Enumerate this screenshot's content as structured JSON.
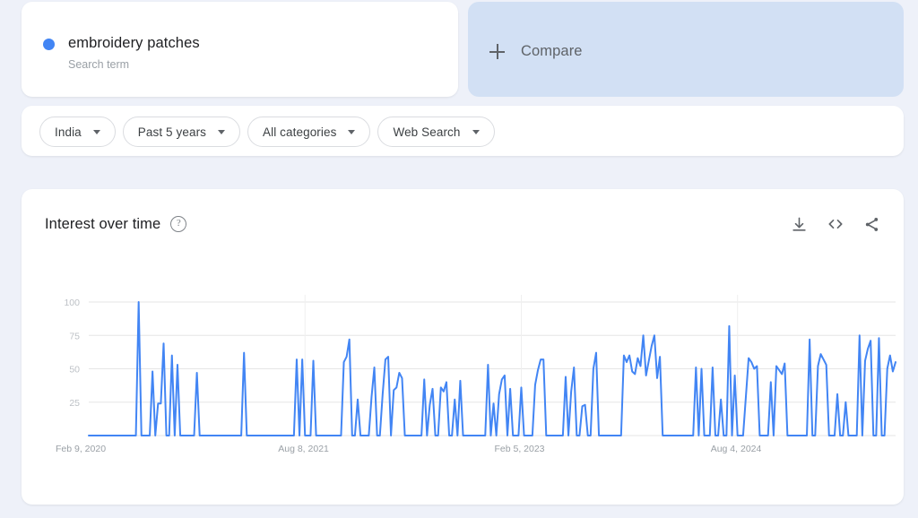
{
  "search_term": {
    "name": "embroidery patches",
    "type_label": "Search term",
    "dot_color": "#4285f4"
  },
  "compare": {
    "label": "Compare",
    "icon": "plus-icon"
  },
  "filters": [
    {
      "label": "India",
      "name": "location-filter"
    },
    {
      "label": "Past 5 years",
      "name": "time-range-filter"
    },
    {
      "label": "All categories",
      "name": "category-filter"
    },
    {
      "label": "Web Search",
      "name": "search-type-filter"
    }
  ],
  "chart_panel": {
    "title": "Interest over time",
    "help_icon": "help-circle-icon",
    "tools": [
      {
        "name": "download-icon",
        "label": "Download"
      },
      {
        "name": "embed-code-icon",
        "label": "Embed"
      },
      {
        "name": "share-icon",
        "label": "Share"
      }
    ]
  },
  "chart_data": {
    "type": "line",
    "title": "Interest over time",
    "xlabel": "",
    "ylabel": "",
    "ylim": [
      0,
      100
    ],
    "yticks": [
      25,
      50,
      75,
      100
    ],
    "grid": true,
    "legend": false,
    "line_color": "#4285f4",
    "x_tick_labels": [
      "Feb 9, 2020",
      "Aug 8, 2021",
      "Feb 5, 2023",
      "Aug 4, 2024"
    ],
    "x_tick_positions": [
      0,
      78,
      156,
      234
    ],
    "series": [
      {
        "name": "embroidery patches",
        "values": [
          0,
          0,
          0,
          0,
          0,
          0,
          0,
          0,
          0,
          0,
          0,
          0,
          0,
          0,
          0,
          0,
          0,
          0,
          100,
          0,
          0,
          0,
          0,
          48,
          0,
          24,
          24,
          69,
          0,
          0,
          60,
          0,
          53,
          0,
          0,
          0,
          0,
          0,
          0,
          47,
          0,
          0,
          0,
          0,
          0,
          0,
          0,
          0,
          0,
          0,
          0,
          0,
          0,
          0,
          0,
          0,
          62,
          0,
          0,
          0,
          0,
          0,
          0,
          0,
          0,
          0,
          0,
          0,
          0,
          0,
          0,
          0,
          0,
          0,
          0,
          57,
          0,
          57,
          0,
          0,
          0,
          56,
          0,
          0,
          0,
          0,
          0,
          0,
          0,
          0,
          0,
          0,
          55,
          59,
          72,
          0,
          0,
          27,
          0,
          0,
          0,
          0,
          29,
          51,
          0,
          0,
          31,
          57,
          59,
          0,
          34,
          36,
          47,
          43,
          0,
          0,
          0,
          0,
          0,
          0,
          0,
          42,
          0,
          23,
          35,
          0,
          0,
          36,
          33,
          40,
          0,
          0,
          27,
          0,
          41,
          0,
          0,
          0,
          0,
          0,
          0,
          0,
          0,
          0,
          53,
          0,
          24,
          0,
          31,
          42,
          45,
          0,
          35,
          0,
          0,
          0,
          36,
          0,
          0,
          0,
          0,
          38,
          49,
          57,
          57,
          0,
          0,
          0,
          0,
          0,
          0,
          0,
          44,
          0,
          33,
          51,
          0,
          0,
          22,
          23,
          0,
          0,
          50,
          62,
          0,
          0,
          0,
          0,
          0,
          0,
          0,
          0,
          0,
          60,
          55,
          60,
          48,
          46,
          58,
          52,
          75,
          45,
          56,
          67,
          75,
          43,
          59,
          0,
          0,
          0,
          0,
          0,
          0,
          0,
          0,
          0,
          0,
          0,
          0,
          51,
          0,
          50,
          0,
          0,
          0,
          51,
          0,
          0,
          27,
          0,
          0,
          82,
          0,
          45,
          0,
          0,
          0,
          29,
          58,
          55,
          50,
          52,
          0,
          0,
          0,
          0,
          40,
          0,
          52,
          49,
          46,
          54,
          0,
          0,
          0,
          0,
          0,
          0,
          0,
          0,
          72,
          0,
          0,
          52,
          61,
          57,
          53,
          0,
          0,
          0,
          31,
          0,
          0,
          25,
          0,
          0,
          0,
          0,
          75,
          0,
          56,
          65,
          71,
          0,
          0,
          73,
          0,
          0,
          50,
          60,
          48,
          55
        ]
      }
    ]
  }
}
